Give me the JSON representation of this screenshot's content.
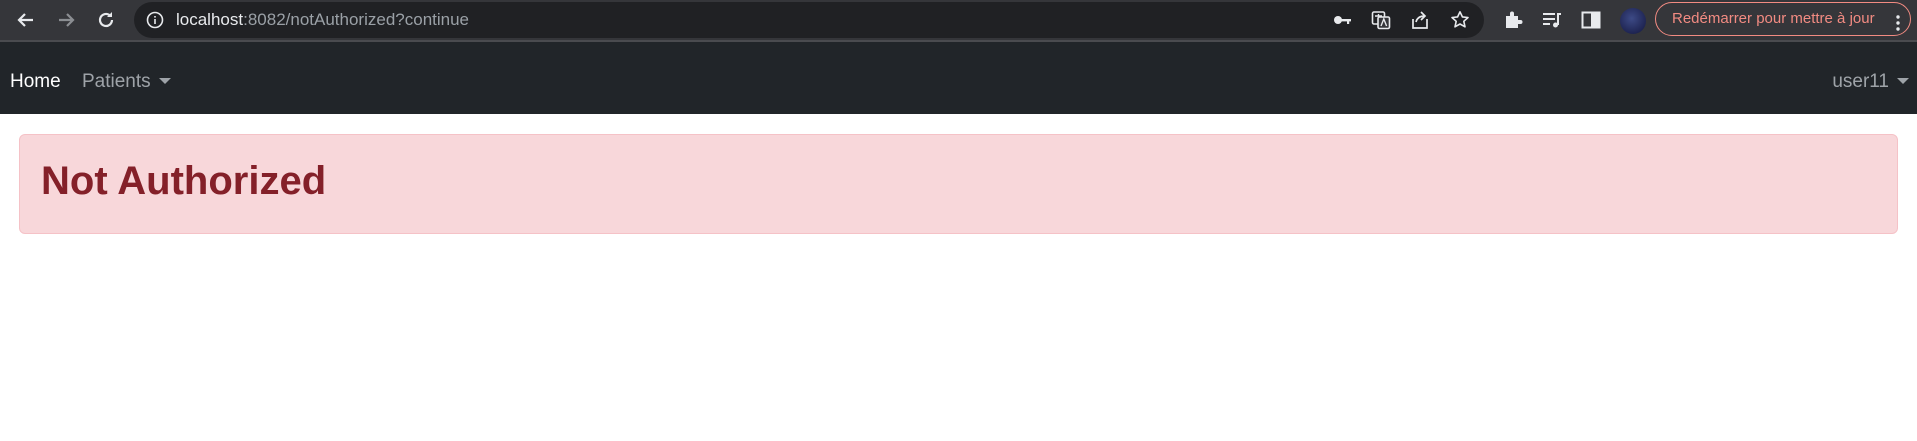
{
  "browser": {
    "url_host": "localhost",
    "url_rest": ":8082/notAuthorized?continue",
    "update_button_label": "Redémarrer pour mettre à jour"
  },
  "navbar": {
    "brand": "Home",
    "menu_patients": "Patients",
    "user_menu": "user11"
  },
  "alert": {
    "message": "Not Authorized",
    "colors": {
      "background": "#f8d7da",
      "border": "#f5c2c7",
      "text": "#842029"
    }
  }
}
